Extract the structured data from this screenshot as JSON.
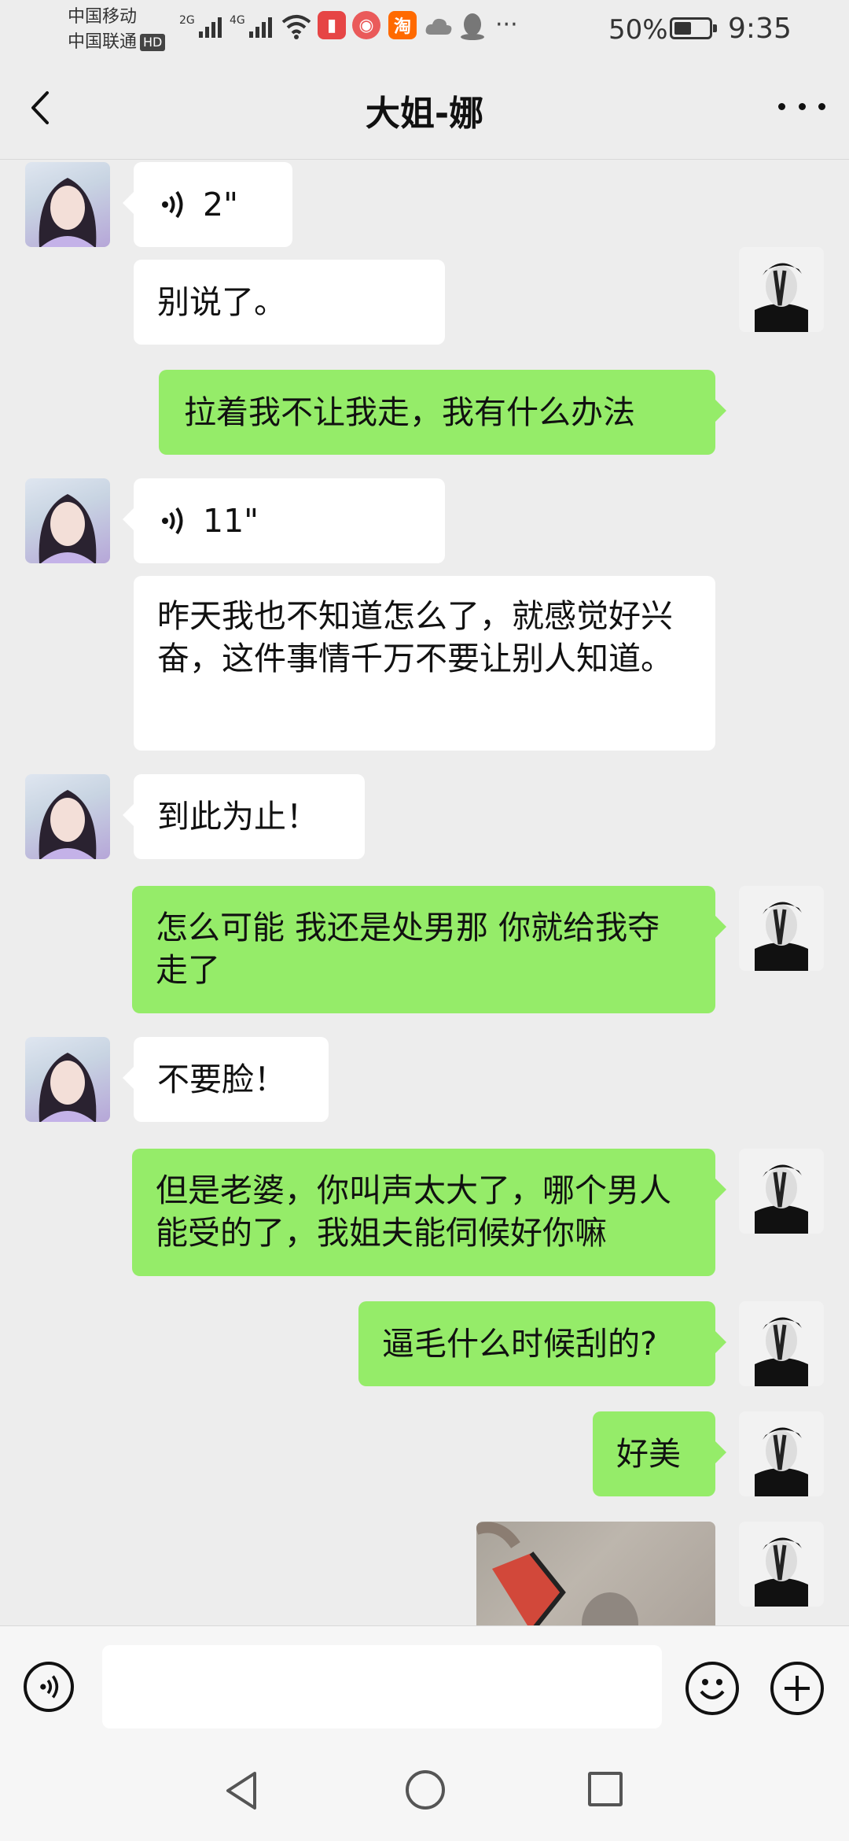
{
  "status_bar": {
    "carrier1": "中国移动",
    "carrier2": "中国联通",
    "hd": "HD",
    "net1": "2G",
    "net2": "4G",
    "battery_percent": "50%",
    "battery_level": 0.5,
    "time": "9:35",
    "icons": [
      "signal-icon",
      "wifi-icon",
      "book-app-icon",
      "podcast-app-icon",
      "taobao-app-icon",
      "cloud-icon",
      "qq-icon",
      "more-notifications-icon"
    ],
    "taobao_glyph": "淘",
    "more_glyph": "···"
  },
  "header": {
    "title": "大姐-娜"
  },
  "messages": [
    {
      "side": "left",
      "type": "voice",
      "duration": "2\""
    },
    {
      "side": "left",
      "type": "text",
      "text": "别说了。"
    },
    {
      "side": "right",
      "type": "text",
      "text": "拉着我不让我走，我有什么办法"
    },
    {
      "side": "left",
      "type": "voice",
      "duration": "11\""
    },
    {
      "side": "left",
      "type": "text",
      "text": "昨天我也不知道怎么了，就感觉好兴奋，这件事情千万不要让别人知道。"
    },
    {
      "side": "left",
      "type": "text",
      "text": "到此为止！"
    },
    {
      "side": "right",
      "type": "text",
      "text": "怎么可能 我还是处男那 你就给我夺走了"
    },
    {
      "side": "left",
      "type": "text",
      "text": "不要脸！"
    },
    {
      "side": "right",
      "type": "text",
      "text": "但是老婆，你叫声太大了，哪个男人能受的了，我姐夫能伺候好你嘛"
    },
    {
      "side": "right",
      "type": "text",
      "text": "逼毛什么时候刮的?"
    },
    {
      "side": "right",
      "type": "text",
      "text": "好美"
    },
    {
      "side": "right",
      "type": "image"
    }
  ],
  "input_bar": {
    "voice_icon": "voice-input-icon",
    "emoji_icon": "emoji-icon",
    "plus_icon": "add-more-icon",
    "input_value": ""
  },
  "nav_bar": {
    "icons": [
      "back-nav-icon",
      "home-nav-icon",
      "recents-nav-icon"
    ]
  }
}
